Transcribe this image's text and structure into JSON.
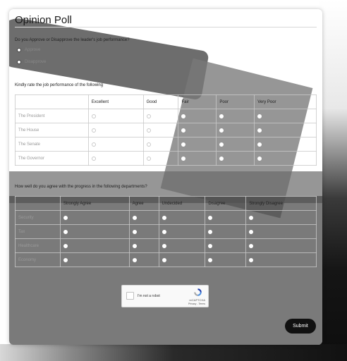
{
  "form": {
    "title": "Opinion Poll",
    "q1": {
      "text": "Do you Approve or Disapprove the leader's job performance?",
      "options": [
        "Approve",
        "Disapprove"
      ]
    },
    "q2": {
      "text": "Kindly rate the job performance of the following",
      "columns": [
        "Excellent",
        "Good",
        "Fair",
        "Poor",
        "Very Poor"
      ],
      "rows": [
        "The President",
        "The House",
        "The Senate",
        "The Governor"
      ]
    },
    "q3": {
      "text": "How well do you agree with the progress in the following departments?",
      "columns": [
        "Strongly Agree",
        "Agree",
        "Undecided",
        "Disagree",
        "Strongly Disagree"
      ],
      "rows": [
        "Security",
        "Tax",
        "Healthcare",
        "Economy"
      ]
    },
    "captcha": {
      "label": "I'm not a robot",
      "brand": "reCAPTCHA",
      "terms": "Privacy - Terms"
    },
    "submit_label": "Submit"
  },
  "colors": {
    "button_bg": "#111111",
    "button_text": "#ffffff",
    "recaptcha_blue": "#1c3aa9",
    "recaptcha_light": "#4a90e2"
  }
}
